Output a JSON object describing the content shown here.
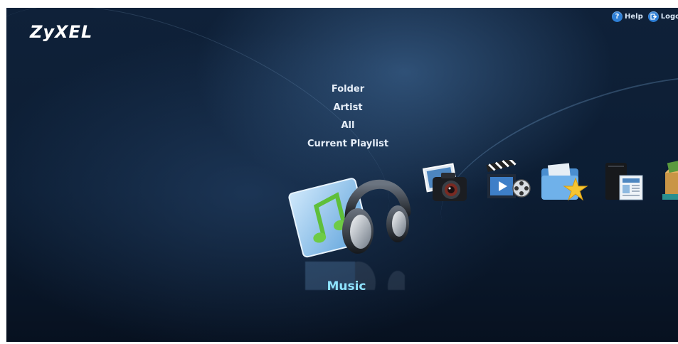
{
  "header": {
    "logo": "ZyXEL",
    "help_label": "Help",
    "logout_label": "Logou"
  },
  "menu": {
    "items": [
      "Folder",
      "Artist",
      "All",
      "Current Playlist"
    ]
  },
  "carousel": {
    "selected_label": "Music",
    "apps": [
      {
        "name": "music",
        "icon": "headphones-music-icon"
      },
      {
        "name": "photo",
        "icon": "camera-photo-icon"
      },
      {
        "name": "video",
        "icon": "clapperboard-video-icon"
      },
      {
        "name": "favorites",
        "icon": "folder-star-icon"
      },
      {
        "name": "file-browser",
        "icon": "nas-document-icon"
      },
      {
        "name": "download",
        "icon": "package-icon"
      }
    ]
  },
  "colors": {
    "accent": "#8fe3ff",
    "background": "#0f2139",
    "help_icon": "#2e7fd6"
  }
}
